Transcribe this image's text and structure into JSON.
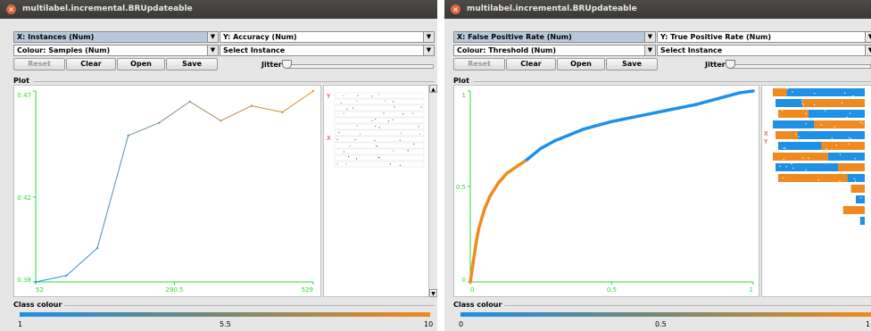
{
  "windows": [
    {
      "title": "multilabel.incremental.BRUpdateable",
      "x_axis": "X: Instances (Num)",
      "y_axis": "Y: Accuracy (Num)",
      "colour": "Colour: Samples (Num)",
      "instance": "Select Instance",
      "buttons": {
        "reset": "Reset",
        "clear": "Clear",
        "open": "Open",
        "save": "Save"
      },
      "jitter_label": "Jitter",
      "plot_label": "Plot",
      "class_colour_label": "Class colour",
      "matrix_labels": [
        "Y",
        "X"
      ],
      "colour_ticks": [
        "1",
        "5.5",
        "10"
      ],
      "colour_stops": [
        "#1e90e6",
        "#7a8a70",
        "#f08a1e"
      ],
      "chart_data": {
        "type": "line",
        "x": [
          52,
          105,
          158,
          211,
          264,
          317,
          370,
          423,
          476,
          529
        ],
        "values": [
          0.38,
          0.383,
          0.396,
          0.449,
          0.455,
          0.465,
          0.456,
          0.463,
          0.46,
          0.47
        ],
        "ylim": [
          0.38,
          0.47
        ],
        "xlim": [
          52,
          529
        ],
        "xticks": [
          "52",
          "290.5",
          "529"
        ],
        "yticks": [
          "0.38",
          "0.42",
          "0.47"
        ],
        "axis_color": "#2fd82f",
        "grid": false
      }
    },
    {
      "title": "multilabel.incremental.BRUpdateable",
      "x_axis": "X: False Positive Rate (Num)",
      "y_axis": "Y: True Positive Rate (Num)",
      "colour": "Colour: Threshold (Num)",
      "instance": "Select Instance",
      "buttons": {
        "reset": "Reset",
        "clear": "Clear",
        "open": "Open",
        "save": "Save"
      },
      "jitter_label": "Jitter",
      "plot_label": "Plot",
      "class_colour_label": "Class colour",
      "matrix_labels": [
        "X",
        "Y"
      ],
      "colour_ticks": [
        "0",
        "0.5",
        "1"
      ],
      "colour_stops": [
        "#1e90e6",
        "#7a8a70",
        "#f08a1e"
      ],
      "chart_data": {
        "type": "line",
        "x": [
          0,
          0.01,
          0.02,
          0.03,
          0.05,
          0.07,
          0.1,
          0.13,
          0.16,
          0.2,
          0.25,
          0.3,
          0.35,
          0.4,
          0.5,
          0.6,
          0.7,
          0.8,
          0.9,
          0.95,
          1.0
        ],
        "values": [
          0,
          0.1,
          0.2,
          0.28,
          0.38,
          0.45,
          0.52,
          0.57,
          0.6,
          0.64,
          0.7,
          0.74,
          0.77,
          0.8,
          0.84,
          0.87,
          0.9,
          0.93,
          0.97,
          0.99,
          1.0
        ],
        "colour_split_x": 0.2,
        "xlim": [
          0,
          1
        ],
        "ylim": [
          0,
          1
        ],
        "xticks": [
          "0",
          "0.5",
          "1"
        ],
        "yticks": [
          "0",
          "0.5",
          "1"
        ],
        "axis_color": "#2fd82f",
        "grid": false
      }
    }
  ],
  "colors": {
    "orange": "#f08a1e",
    "blue": "#1e90e6",
    "axis": "#2fd82f",
    "title_bg": "#3c3b37",
    "close": "#e0643b"
  }
}
